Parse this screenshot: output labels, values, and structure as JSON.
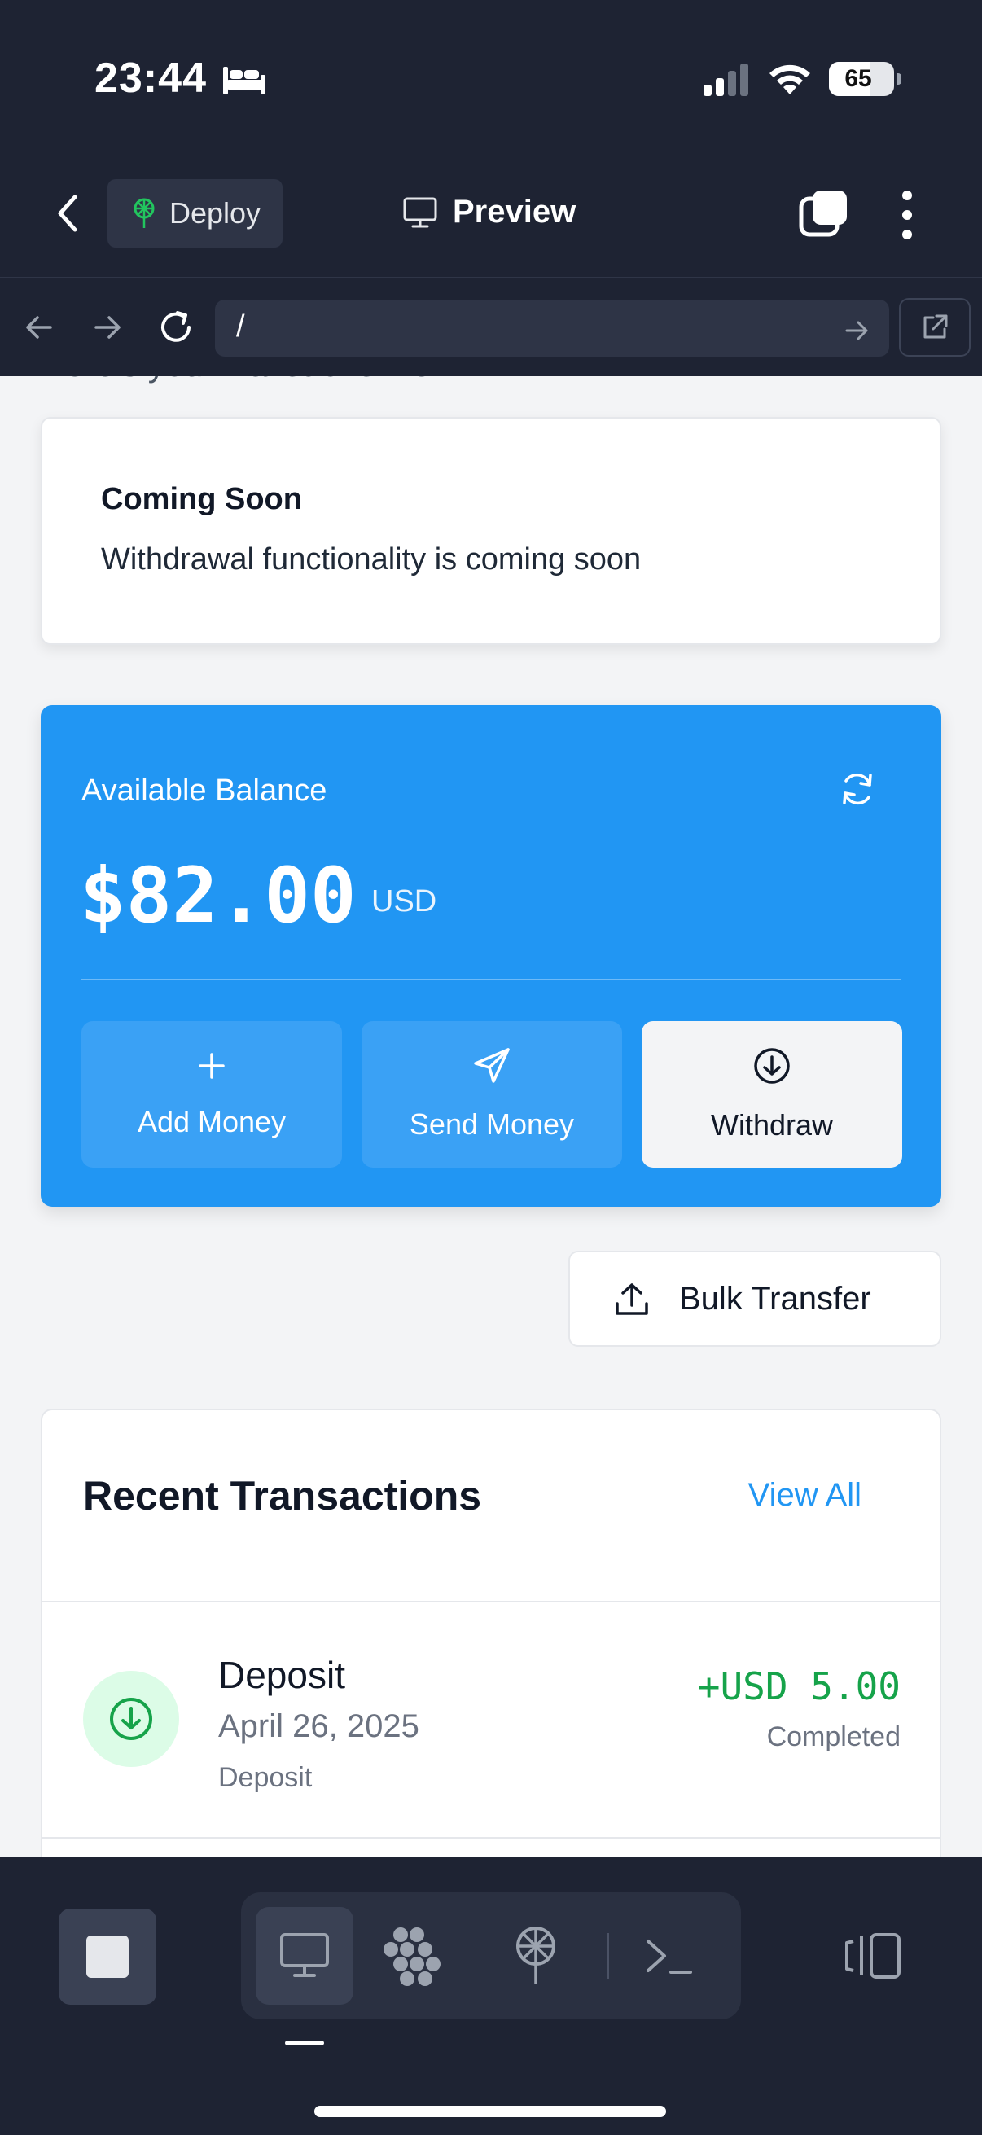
{
  "status_bar": {
    "time": "23:44",
    "battery": "65"
  },
  "app_bar": {
    "deploy_label": "Deploy",
    "preview_label": "Preview"
  },
  "browser": {
    "url": "/"
  },
  "page": {
    "cut_heading": "Here's your wallet overview",
    "notice": {
      "title": "Coming Soon",
      "body": "Withdrawal functionality is coming soon"
    },
    "balance": {
      "label": "Available Balance",
      "amount": "$82.00",
      "currency": "USD",
      "actions": {
        "add": "Add Money",
        "send": "Send Money",
        "withdraw": "Withdraw"
      }
    },
    "bulk_transfer_label": "Bulk Transfer",
    "transactions": {
      "title": "Recent Transactions",
      "view_all": "View All",
      "items": [
        {
          "type": "Deposit",
          "date": "April 26, 2025",
          "description": "Deposit",
          "amount": "+USD 5.00",
          "status": "Completed"
        }
      ]
    }
  },
  "colors": {
    "primary": "#2196f3",
    "dark_chrome": "#1e2333",
    "success": "#16a34a"
  }
}
